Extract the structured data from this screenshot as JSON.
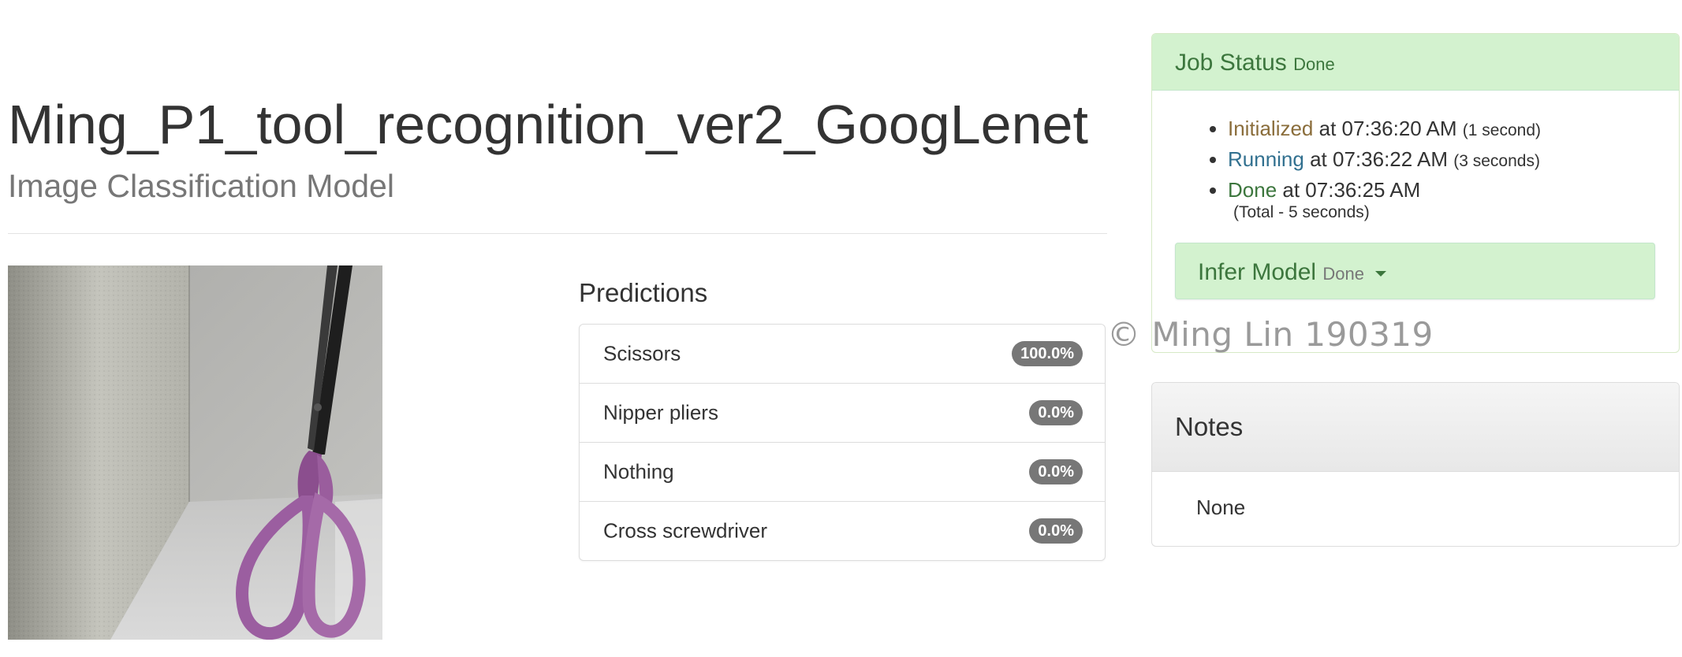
{
  "header": {
    "title": "Ming_P1_tool_recognition_ver2_GoogLenet",
    "subtitle": "Image Classification Model"
  },
  "image": {
    "alt": "Photo of purple-handled scissors standing upright next to a textured wall"
  },
  "predictions": {
    "title": "Predictions",
    "items": [
      {
        "label": "Scissors",
        "value": "100.0%"
      },
      {
        "label": "Nipper pliers",
        "value": "0.0%"
      },
      {
        "label": "Nothing",
        "value": "0.0%"
      },
      {
        "label": "Cross screwdriver",
        "value": "0.0%"
      }
    ]
  },
  "job_status": {
    "title": "Job Status",
    "state": "Done",
    "steps": [
      {
        "status": "Initialized",
        "text": "at 07:36:20 AM",
        "duration": "(1 second)"
      },
      {
        "status": "Running",
        "text": "at 07:36:22 AM",
        "duration": "(3 seconds)"
      },
      {
        "status": "Done",
        "text": "at 07:36:25 AM",
        "duration": ""
      }
    ],
    "total": "(Total - 5 seconds)",
    "infer": {
      "title": "Infer Model",
      "state": "Done"
    }
  },
  "watermark": "© Ming Lin 190319",
  "notes": {
    "title": "Notes",
    "body": "None"
  },
  "colors": {
    "success_bg": "#d3f2cf",
    "success_text": "#3c763d",
    "warning_text": "#8a6d3b",
    "info_text": "#31708f",
    "badge_bg": "#777777"
  }
}
